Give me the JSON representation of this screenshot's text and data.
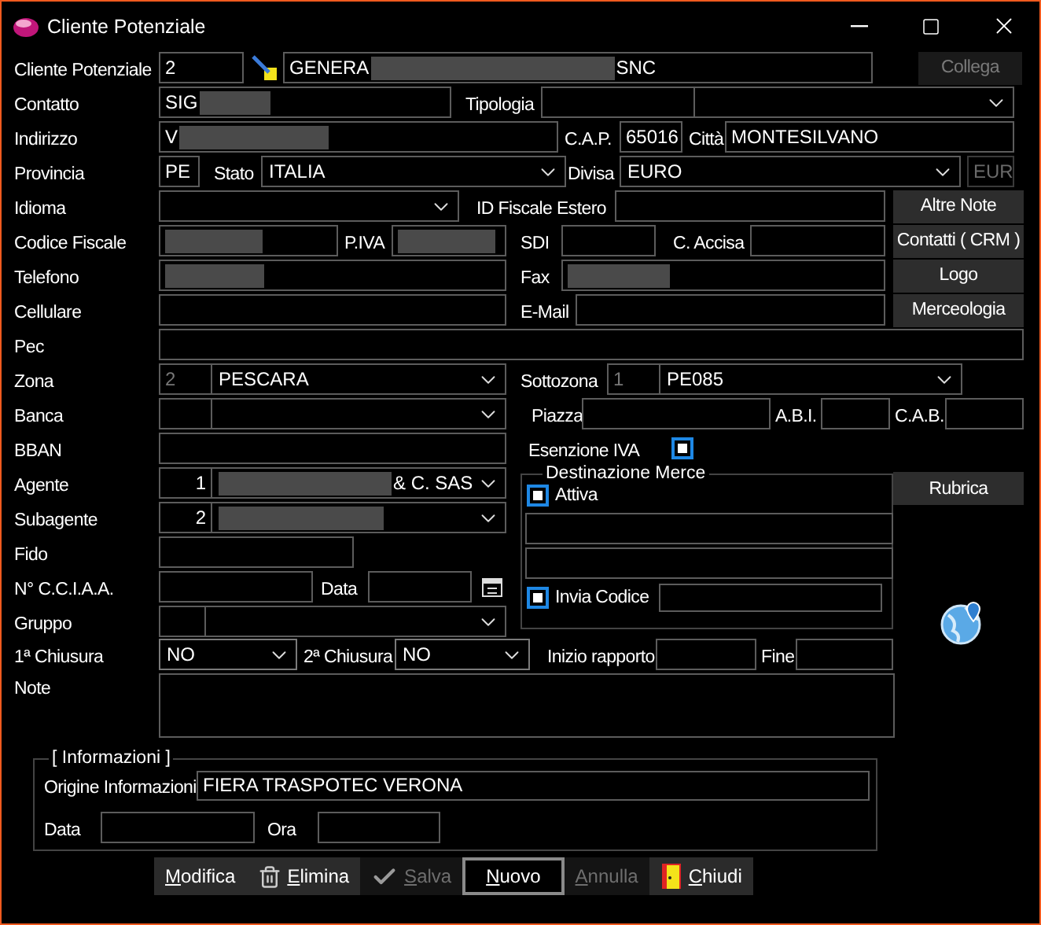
{
  "window": {
    "title": "Cliente Potenziale"
  },
  "cliente": {
    "label": "Cliente Potenziale",
    "code": "2",
    "name": {
      "text": "GENERA",
      "redacted": true,
      "suffix": "SNC"
    }
  },
  "collega_button": {
    "label": "Collega",
    "disabled": true
  },
  "contatto": {
    "label": "Contatto",
    "value": {
      "text": "SIG",
      "redacted": true
    }
  },
  "tipologia": {
    "label": "Tipologia"
  },
  "indirizzo": {
    "label": "Indirizzo",
    "value": {
      "text": "V",
      "redacted": true
    }
  },
  "cap": {
    "label": "C.A.P.",
    "value": "65016"
  },
  "citta": {
    "label": "Città",
    "value": "MONTESILVANO"
  },
  "provincia": {
    "label": "Provincia",
    "value": "PE"
  },
  "stato": {
    "label": "Stato",
    "value": "ITALIA"
  },
  "divisa": {
    "label": "Divisa",
    "value": "EURO",
    "code": "EUR"
  },
  "idioma": {
    "label": "Idioma"
  },
  "id_fiscale_estero": {
    "label": "ID Fiscale Estero"
  },
  "codice_fiscale": {
    "label": "Codice Fiscale",
    "value": {
      "redacted": true
    }
  },
  "partita_iva": {
    "label": "P.IVA",
    "value": {
      "redacted": true
    }
  },
  "sdi": {
    "label": "SDI"
  },
  "accisa": {
    "label": "C. Accisa"
  },
  "telefono": {
    "label": "Telefono",
    "value": {
      "redacted": true
    }
  },
  "fax": {
    "label": "Fax",
    "value": {
      "redacted": true
    }
  },
  "cellulare": {
    "label": "Cellulare"
  },
  "email": {
    "label": "E-Mail"
  },
  "pec": {
    "label": "Pec"
  },
  "zona": {
    "label": "Zona",
    "code": "2",
    "value": "PESCARA"
  },
  "sottozona": {
    "label": "Sottozona",
    "code": "1",
    "value": "PE085"
  },
  "banca": {
    "label": "Banca"
  },
  "piazza": {
    "label": "Piazza"
  },
  "abi": {
    "label": "A.B.I."
  },
  "cab": {
    "label": "C.A.B."
  },
  "bban": {
    "label": "BBAN"
  },
  "esenzione_iva": {
    "label": "Esenzione IVA",
    "checked": true
  },
  "agente": {
    "label": "Agente",
    "code": "1",
    "value": {
      "redacted": true,
      "suffix": "& C. SAS"
    }
  },
  "subagente": {
    "label": "Subagente",
    "code": "2",
    "value": {
      "redacted": true
    }
  },
  "fido": {
    "label": "Fido"
  },
  "cciaa": {
    "label": "N° C.C.I.A.A."
  },
  "cciaa_data": {
    "label": "Data"
  },
  "gruppo": {
    "label": "Gruppo"
  },
  "destinazione_merce": {
    "title": "Destinazione Merce",
    "attiva": {
      "label": "Attiva",
      "checked": true
    },
    "invia_codice": {
      "label": "Invia Codice",
      "checked": true
    }
  },
  "chiusura_1": {
    "label": "1ª Chiusura",
    "value": "NO"
  },
  "chiusura_2": {
    "label": "2ª Chiusura",
    "value": "NO"
  },
  "inizio_rapporto": {
    "label": "Inizio rapporto"
  },
  "fine": {
    "label": "Fine"
  },
  "note": {
    "label": "Note"
  },
  "informazioni": {
    "title": "[ Informazioni ]",
    "origine": {
      "label": "Origine Informazioni",
      "value": "FIERA TRASPOTEC VERONA"
    },
    "data": {
      "label": "Data"
    },
    "ora": {
      "label": "Ora"
    }
  },
  "side_buttons": [
    {
      "label": "Altre Note"
    },
    {
      "label": "Contatti ( CRM )"
    },
    {
      "label": "Logo"
    },
    {
      "label": "Merceologia"
    },
    {
      "label": "Rubrica"
    }
  ],
  "toolbar": [
    {
      "label": "Modifica",
      "kind": "plain",
      "disabled": false,
      "focused": false
    },
    {
      "label": "Elimina",
      "kind": "delete",
      "disabled": false,
      "focused": false
    },
    {
      "label": "Salva",
      "kind": "save",
      "disabled": true,
      "focused": false
    },
    {
      "label": "Nuovo",
      "kind": "plain",
      "disabled": false,
      "focused": true
    },
    {
      "label": "Annulla",
      "kind": "plain",
      "disabled": true,
      "focused": false
    },
    {
      "label": "Chiudi",
      "kind": "exit",
      "disabled": false,
      "focused": false
    }
  ]
}
